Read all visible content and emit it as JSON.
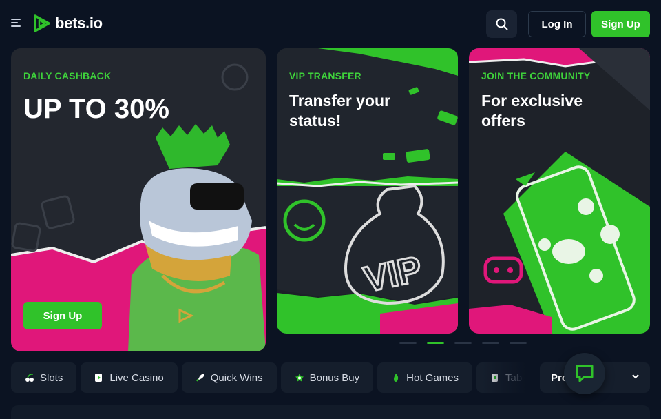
{
  "header": {
    "logo_text": "bets.io",
    "login_label": "Log In",
    "signup_label": "Sign Up"
  },
  "promos": [
    {
      "eyebrow": "DAILY CASHBACK",
      "headline": "UP TO 30%",
      "button_label": "Sign Up"
    },
    {
      "eyebrow": "VIP TRANSFER",
      "headline": "Transfer your status!",
      "art_text": "VIP"
    },
    {
      "eyebrow": "JOIN THE COMMUNITY",
      "headline": "For exclusive offers"
    }
  ],
  "carousel": {
    "count": 5,
    "active_index": 1
  },
  "categories": [
    {
      "label": "Slots",
      "icon": "cherries-icon"
    },
    {
      "label": "Live Casino",
      "icon": "live-play-icon"
    },
    {
      "label": "Quick Wins",
      "icon": "rocket-icon"
    },
    {
      "label": "Bonus Buy",
      "icon": "bonus-icon"
    },
    {
      "label": "Hot Games",
      "icon": "flame-icon"
    },
    {
      "label": "Tab",
      "icon": "table-icon"
    }
  ],
  "providers": {
    "label": "Pro"
  },
  "colors": {
    "accent": "#30c22a",
    "background": "#0b1322",
    "pink": "#e0177a"
  }
}
